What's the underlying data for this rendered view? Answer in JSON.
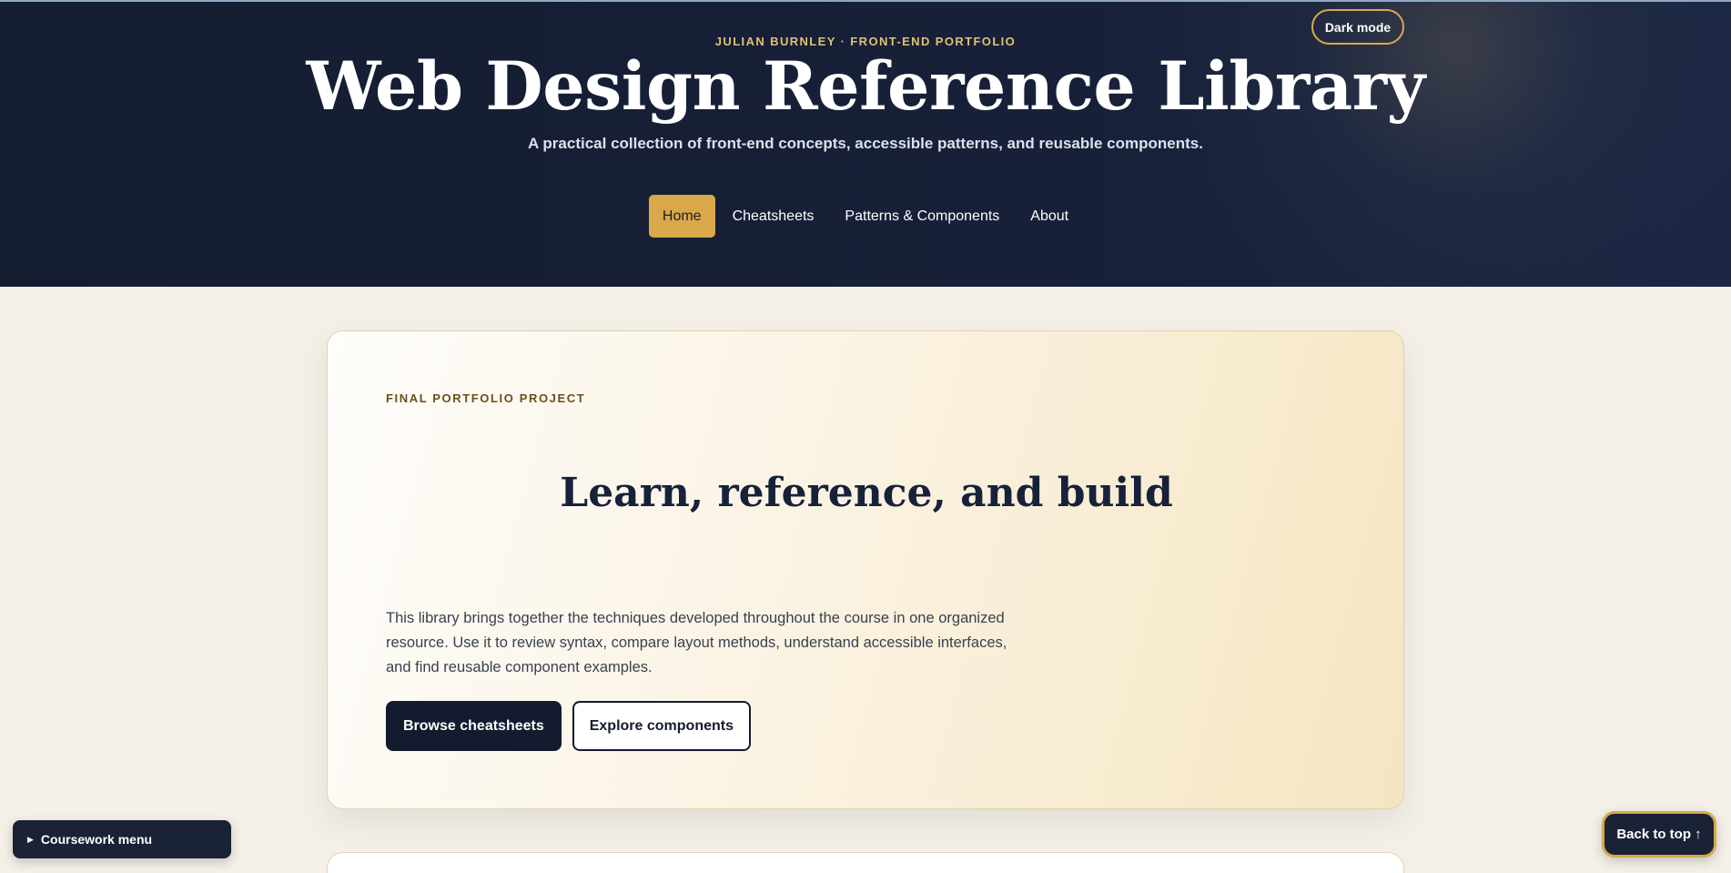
{
  "header": {
    "kicker": "JULIAN BURNLEY · FRONT-END PORTFOLIO",
    "title": "Web Design Reference Library",
    "subtitle": "A practical collection of front-end concepts, accessible patterns, and reusable components.",
    "dark_mode_label": "Dark mode"
  },
  "nav": {
    "items": [
      {
        "label": "Home",
        "active": true
      },
      {
        "label": "Cheatsheets",
        "active": false
      },
      {
        "label": "Patterns & Components",
        "active": false
      },
      {
        "label": "About",
        "active": false
      }
    ]
  },
  "intro_card": {
    "eyebrow": "FINAL PORTFOLIO PROJECT",
    "title": "Learn, reference, and build",
    "body": "This library brings together the techniques developed throughout the course in one organized resource. Use it to review syntax, compare layout methods, understand accessible interfaces, and find reusable component examples.",
    "primary_button": "Browse cheatsheets",
    "secondary_button": "Explore components"
  },
  "floating": {
    "coursework_menu": "Coursework menu",
    "back_to_top": "Back to top ↑"
  },
  "colors": {
    "accent": "#d9a84a",
    "navy": "#141b2e",
    "page_bg": "#f4f0e8"
  }
}
